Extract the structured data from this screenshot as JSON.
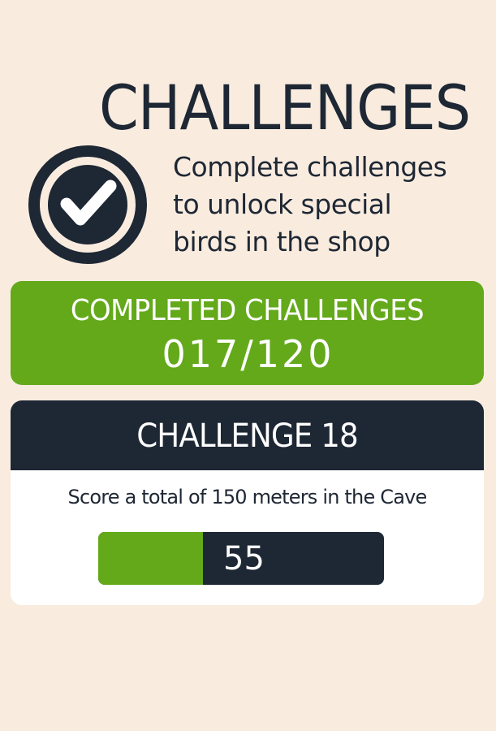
{
  "header": {
    "title": "CHALLENGES"
  },
  "intro": {
    "line1": "Complete challenges",
    "line2": "to unlock special",
    "line3": "birds in the shop",
    "icon": "checkmark-badge-icon"
  },
  "completed": {
    "label": "COMPLETED CHALLENGES",
    "count_text": "017/120",
    "completed": 17,
    "total": 120
  },
  "current_challenge": {
    "title": "CHALLENGE 18",
    "description": "Score a total of 150 meters in the Cave",
    "progress_value_text": "55",
    "progress_current": 55,
    "progress_target": 150
  },
  "colors": {
    "background": "#f9ecdf",
    "dark": "#1e2734",
    "green": "#63a91a",
    "card": "#ffffff"
  }
}
